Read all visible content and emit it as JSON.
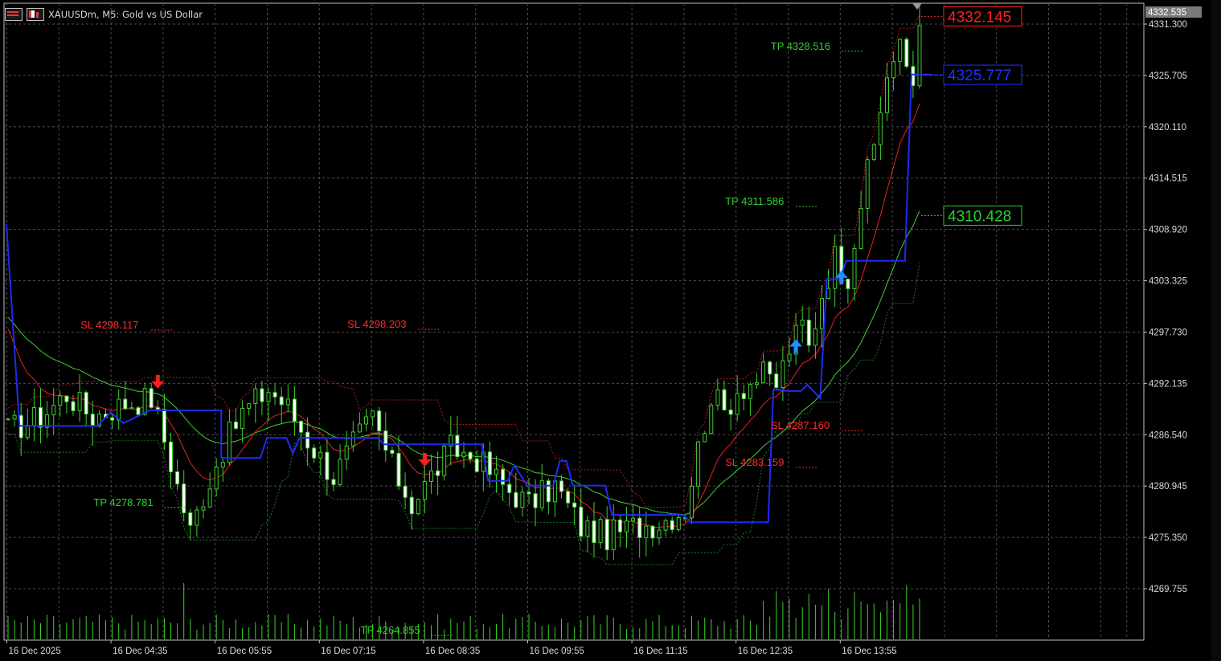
{
  "window": {
    "title": "XAUUSDm, M5:  Gold vs US Dollar"
  },
  "colors": {
    "background": "#000000",
    "grid": "#4d4d4d",
    "axis_text": "#d9d9d9",
    "candle": "#3fcf2e",
    "candle_body_up": "#000000",
    "candle_body_down": "#ffffff",
    "ma_fast": "#e52323",
    "ma_slow": "#3fcf2e",
    "envelope_upper": "#b21b1b",
    "envelope_lower": "#1f7a1f",
    "trend_step": "#1e2cf2",
    "sell_arrow": "#ff1e1e",
    "buy_arrow": "#1e8fff",
    "sl_text": "#ff2a2a",
    "tp_text": "#2bd22b",
    "volume": "#3fcf2e"
  },
  "chart_data": {
    "type": "candlestick",
    "symbol": "XAUUSDm",
    "timeframe": "M5",
    "ylim": [
      4264.0,
      4334.0
    ],
    "y_ticks": [
      4331.3,
      4325.705,
      4320.11,
      4314.515,
      4308.92,
      4303.325,
      4297.73,
      4292.135,
      4286.54,
      4280.945,
      4275.35,
      4269.755
    ],
    "y_tick_labels": [
      "4331.300",
      "4325.705",
      "4320.110",
      "4314.515",
      "4308.920",
      "4303.325",
      "4297.730",
      "4292.135",
      "4286.540",
      "4280.945",
      "4275.350",
      "4269.755"
    ],
    "x_ticks": [
      {
        "label": "16 Dec 2025",
        "bar": 0
      },
      {
        "label": "16 Dec 04:35",
        "bar": 16
      },
      {
        "label": "16 Dec 05:55",
        "bar": 32
      },
      {
        "label": "16 Dec 07:15",
        "bar": 48
      },
      {
        "label": "16 Dec 08:35",
        "bar": 64
      },
      {
        "label": "16 Dec 09:55",
        "bar": 80
      },
      {
        "label": "16 Dec 11:15",
        "bar": 96
      },
      {
        "label": "16 Dec 12:35",
        "bar": 112
      },
      {
        "label": "16 Dec 13:55",
        "bar": 128
      }
    ],
    "bars_visible": 141,
    "current_price": "4332.535",
    "price_labels": [
      {
        "text": "4332.145",
        "value": 4332.145,
        "color": "#ff2020",
        "line": "upper"
      },
      {
        "text": "4325.777",
        "value": 4325.777,
        "color": "#2030ff",
        "line": "trend"
      },
      {
        "text": "4310.428",
        "value": 4310.428,
        "color": "#2bd22b",
        "line": "lower"
      }
    ],
    "sl_tp_annotations": [
      {
        "text": "SL 4298.117",
        "bar": 22,
        "value": 4298.117,
        "kind": "sl"
      },
      {
        "text": "SL 4298.203",
        "bar": 63,
        "value": 4298.203,
        "kind": "sl"
      },
      {
        "text": "TP 4278.781",
        "bar": 24,
        "value": 4278.781,
        "kind": "tp"
      },
      {
        "text": "TP 4264.855",
        "bar": 65,
        "value": 4264.855,
        "kind": "tp"
      },
      {
        "text": "TP 4311.586",
        "bar": 121,
        "value": 4311.586,
        "kind": "tp"
      },
      {
        "text": "TP 4328.516",
        "bar": 128,
        "value": 4328.516,
        "kind": "tp"
      },
      {
        "text": "SL 4287.160",
        "bar": 128,
        "value": 4287.16,
        "kind": "sl"
      },
      {
        "text": "SL 4283.159",
        "bar": 121,
        "value": 4283.159,
        "kind": "sl"
      }
    ],
    "signals": [
      {
        "type": "sell",
        "bar": 23,
        "value": 4292.0
      },
      {
        "type": "sell",
        "bar": 64,
        "value": 4283.5
      },
      {
        "type": "buy",
        "bar": 121,
        "value": 4296.5
      },
      {
        "type": "buy",
        "bar": 128,
        "value": 4304.0
      }
    ],
    "waypoints": [
      [
        0,
        4287.0
      ],
      [
        5,
        4288.5
      ],
      [
        9,
        4291.0
      ],
      [
        13,
        4288.5
      ],
      [
        18,
        4290.0
      ],
      [
        22,
        4290.5
      ],
      [
        24,
        4286.0
      ],
      [
        26,
        4281.0
      ],
      [
        28,
        4276.0
      ],
      [
        30,
        4280.0
      ],
      [
        33,
        4285.0
      ],
      [
        36,
        4289.0
      ],
      [
        40,
        4291.5
      ],
      [
        43,
        4289.5
      ],
      [
        46,
        4286.0
      ],
      [
        50,
        4282.0
      ],
      [
        53,
        4285.5
      ],
      [
        56,
        4288.5
      ],
      [
        59,
        4283.0
      ],
      [
        62,
        4279.0
      ],
      [
        65,
        4282.0
      ],
      [
        68,
        4285.0
      ],
      [
        72,
        4284.0
      ],
      [
        76,
        4281.0
      ],
      [
        80,
        4279.0
      ],
      [
        84,
        4281.0
      ],
      [
        88,
        4276.5
      ],
      [
        92,
        4275.5
      ],
      [
        96,
        4276.5
      ],
      [
        100,
        4277.0
      ],
      [
        104,
        4278.5
      ],
      [
        106,
        4285.0
      ],
      [
        108,
        4291.0
      ],
      [
        110,
        4289.0
      ],
      [
        112,
        4291.5
      ],
      [
        116,
        4293.0
      ],
      [
        118,
        4292.0
      ],
      [
        120,
        4296.0
      ],
      [
        122,
        4298.5
      ],
      [
        123,
        4296.0
      ],
      [
        125,
        4302.0
      ],
      [
        127,
        4306.0
      ],
      [
        129,
        4304.0
      ],
      [
        131,
        4312.0
      ],
      [
        133,
        4318.0
      ],
      [
        135,
        4326.0
      ],
      [
        137,
        4328.5
      ],
      [
        139,
        4325.0
      ],
      [
        140,
        4332.5
      ]
    ],
    "trend_steps": [
      [
        0,
        4309.5
      ],
      [
        2,
        4287.5
      ],
      [
        14,
        4287.5
      ],
      [
        16,
        4289.0
      ],
      [
        18,
        4287.8
      ],
      [
        22,
        4289.2
      ],
      [
        33,
        4289.2
      ],
      [
        33,
        4284.0
      ],
      [
        39,
        4284.0
      ],
      [
        40,
        4286.2
      ],
      [
        43,
        4286.2
      ],
      [
        44,
        4284.5
      ],
      [
        45,
        4286.2
      ],
      [
        57,
        4286.2
      ],
      [
        58,
        4285.5
      ],
      [
        73,
        4285.5
      ],
      [
        74,
        4281.5
      ],
      [
        77,
        4281.5
      ],
      [
        78,
        4283.2
      ],
      [
        80,
        4281.0
      ],
      [
        84,
        4281.0
      ],
      [
        85,
        4283.7
      ],
      [
        86,
        4283.7
      ],
      [
        87,
        4281.0
      ],
      [
        92,
        4281.0
      ],
      [
        93,
        4277.8
      ],
      [
        104,
        4277.8
      ],
      [
        105,
        4277.0
      ],
      [
        117,
        4277.0
      ],
      [
        117.8,
        4291.5
      ],
      [
        120,
        4291.3
      ],
      [
        122,
        4291.3
      ],
      [
        123,
        4292.0
      ],
      [
        125,
        4290.5
      ],
      [
        126,
        4303.5
      ],
      [
        128,
        4303.5
      ],
      [
        129,
        4305.5
      ],
      [
        138,
        4305.5
      ],
      [
        139,
        4325.8
      ],
      [
        142,
        4325.8
      ]
    ]
  }
}
